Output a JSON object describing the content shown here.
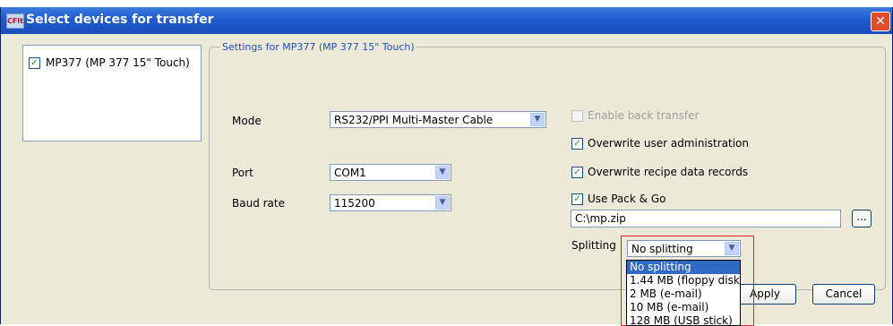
{
  "window": {
    "title": "Select devices for transfer",
    "app_icon_text": "CFlt",
    "close_glyph": "✕"
  },
  "device_list": {
    "items": [
      {
        "label": "MP377 (MP 377 15\" Touch)",
        "checked": true
      }
    ]
  },
  "settings": {
    "group_title": "Settings for MP377 (MP 377 15\" Touch)",
    "mode": {
      "label": "Mode",
      "value": "RS232/PPI Multi-Master Cable"
    },
    "port": {
      "label": "Port",
      "value": "COM1"
    },
    "baud": {
      "label": "Baud rate",
      "value": "115200"
    },
    "options": {
      "enable_back_transfer": {
        "label": "Enable back transfer",
        "checked": false,
        "enabled": false
      },
      "overwrite_user_admin": {
        "label": "Overwrite user administration",
        "checked": true
      },
      "overwrite_recipes": {
        "label": "Overwrite recipe data records",
        "checked": true
      },
      "use_pack_go": {
        "label": "Use Pack & Go",
        "checked": true
      }
    },
    "pack_path": "C:\\mp.zip",
    "browse_label": "...",
    "splitting": {
      "label": "Splitting",
      "value": "No splitting",
      "options": [
        "No splitting",
        "1.44 MB (floppy disk)",
        "2 MB (e-mail)",
        "10 MB (e-mail)",
        "128 MB (USB stick)"
      ]
    }
  },
  "buttons": {
    "apply": "Apply",
    "cancel": "Cancel"
  },
  "glyphs": {
    "check": "✓",
    "combo_arrow": "▼"
  },
  "colors": {
    "titlebar": "#1f5bd0",
    "accent": "#316ac5",
    "highlight": "#e51f1f"
  }
}
